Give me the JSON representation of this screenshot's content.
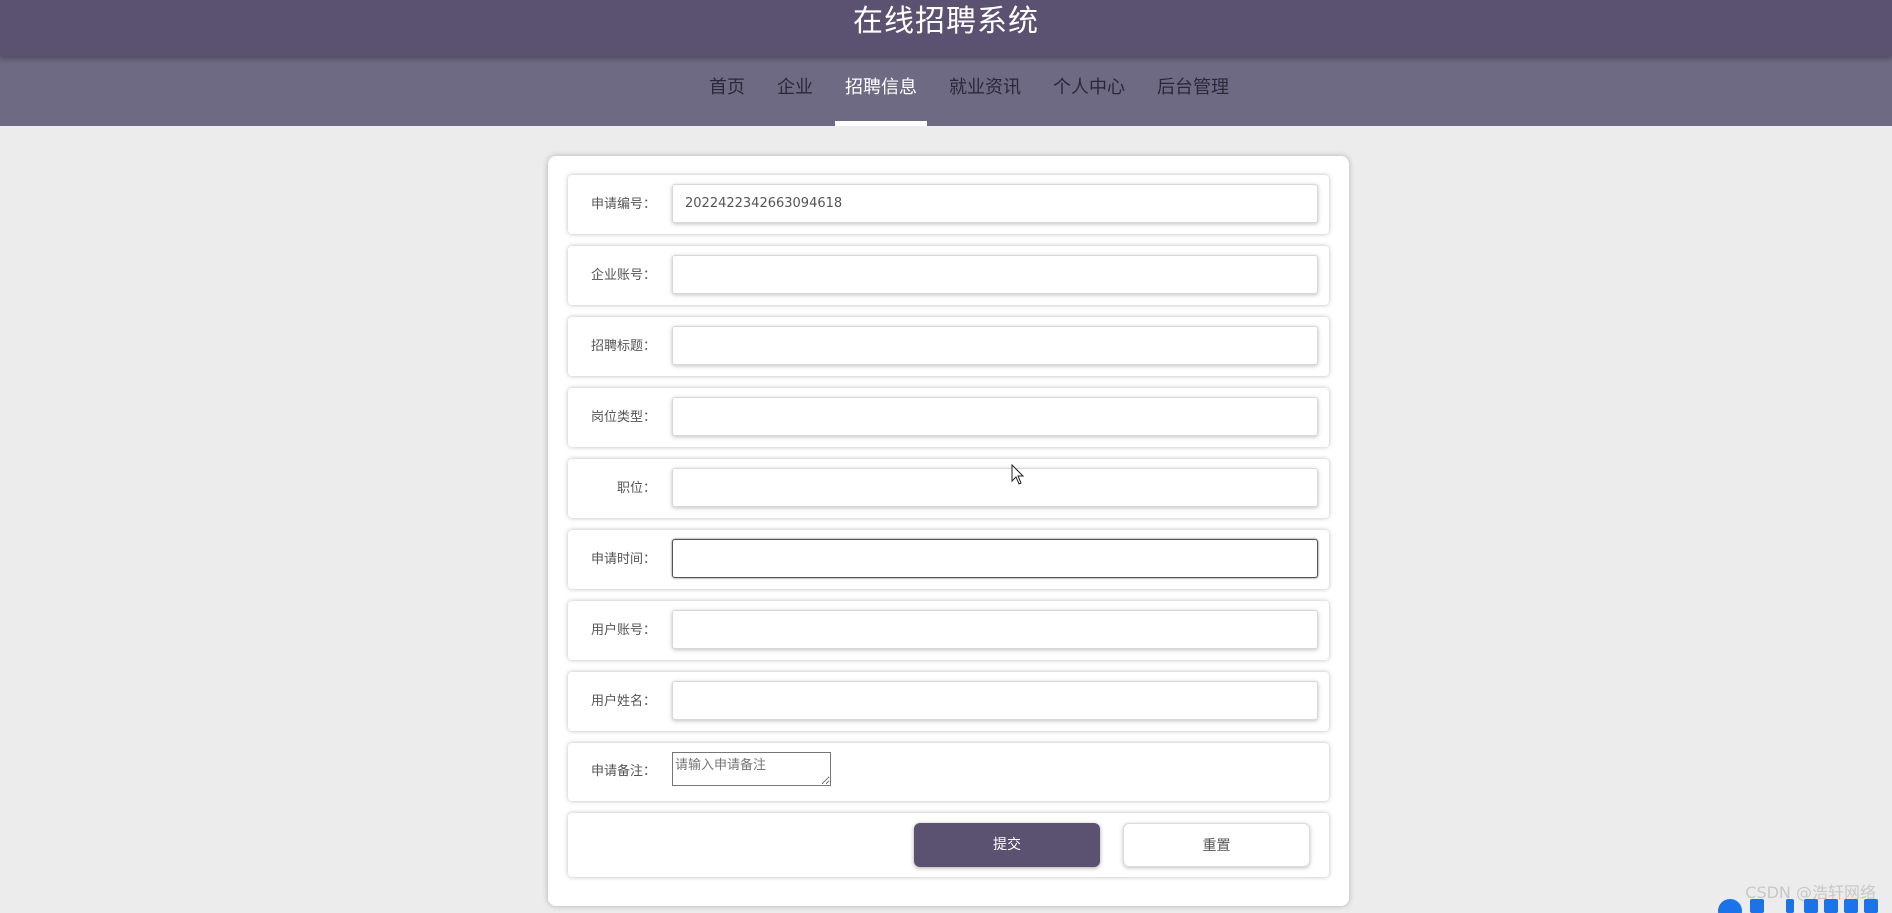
{
  "header": {
    "title": "在线招聘系统"
  },
  "nav": {
    "items": [
      {
        "label": "首页",
        "active": false
      },
      {
        "label": "企业",
        "active": false
      },
      {
        "label": "招聘信息",
        "active": true
      },
      {
        "label": "就业资讯",
        "active": false
      },
      {
        "label": "个人中心",
        "active": false
      },
      {
        "label": "后台管理",
        "active": false
      }
    ]
  },
  "form": {
    "fields": [
      {
        "label": "申请编号：",
        "value": "2022422342663094618"
      },
      {
        "label": "企业账号：",
        "value": ""
      },
      {
        "label": "招聘标题：",
        "value": ""
      },
      {
        "label": "岗位类型：",
        "value": ""
      },
      {
        "label": "职位：",
        "value": ""
      },
      {
        "label": "申请时间：",
        "value": ""
      },
      {
        "label": "用户账号：",
        "value": ""
      },
      {
        "label": "用户姓名：",
        "value": ""
      }
    ],
    "remark": {
      "label": "申请备注：",
      "placeholder": "请输入申请备注"
    },
    "submit_label": "提交",
    "reset_label": "重置"
  },
  "watermark": "CSDN @浩轩网络",
  "colors": {
    "header_bg": "#5a5270",
    "nav_bg": "#6e6a83",
    "page_bg": "#ececec",
    "primary_button": "#5a5270"
  }
}
